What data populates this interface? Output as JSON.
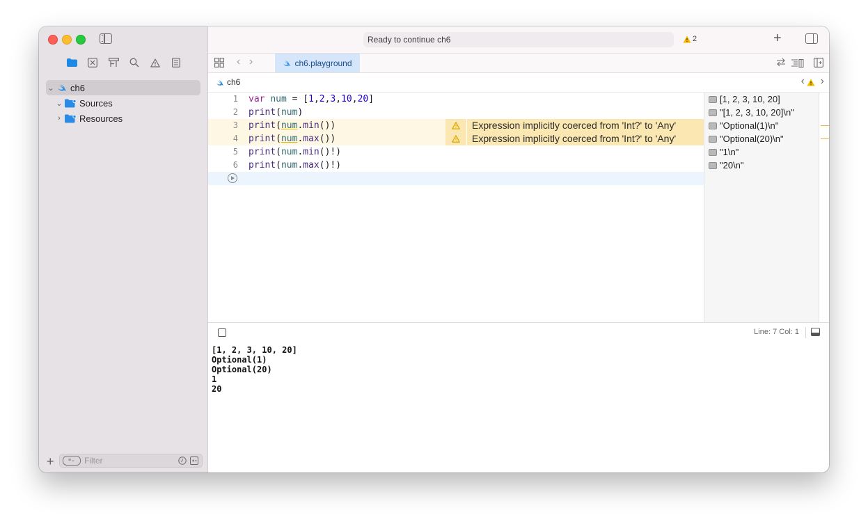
{
  "window": {
    "activity_text": "Ready to continue ch6",
    "warning_count": "2"
  },
  "sidebar": {
    "tree": [
      {
        "label": "ch6",
        "expanded": true,
        "icon": "swift-icon"
      },
      {
        "label": "Sources",
        "expanded": true,
        "icon": "folder-icon"
      },
      {
        "label": "Resources",
        "expanded": false,
        "icon": "folder-icon"
      }
    ],
    "filter_placeholder": "Filter"
  },
  "tabs": [
    {
      "label": "ch6.playground",
      "active": true
    }
  ],
  "jumpbar": {
    "crumb": "ch6"
  },
  "editor": {
    "lines": [
      {
        "n": "1"
      },
      {
        "n": "2"
      },
      {
        "n": "3"
      },
      {
        "n": "4"
      },
      {
        "n": "5"
      },
      {
        "n": "6"
      }
    ],
    "tokens": {
      "var": "var",
      "num": "num",
      "print": "print",
      "min": "min",
      "max": "max",
      "n1": "1",
      "n2": "2",
      "n3": "3",
      "n10": "10",
      "n20": "20"
    },
    "warning_text": "Expression implicitly coerced from 'Int?' to 'Any'"
  },
  "results": [
    "[1, 2, 3, 10, 20]",
    "\"[1, 2, 3, 10, 20]\\n\"",
    "\"Optional(1)\\n\"",
    "\"Optional(20)\\n\"",
    "\"1\\n\"",
    "\"20\\n\""
  ],
  "status": {
    "line_col": "Line: 7  Col: 1"
  },
  "console": [
    "[1, 2, 3, 10, 20]",
    "Optional(1)",
    "Optional(20)",
    "1",
    "20"
  ],
  "colors": {
    "warning_bg": "#fbe7b2",
    "warning_line_bg": "#fdf7e3",
    "current_line_bg": "#ecf4fd",
    "tab_active_bg": "#d5e6fa",
    "accent": "#1e88e5"
  }
}
